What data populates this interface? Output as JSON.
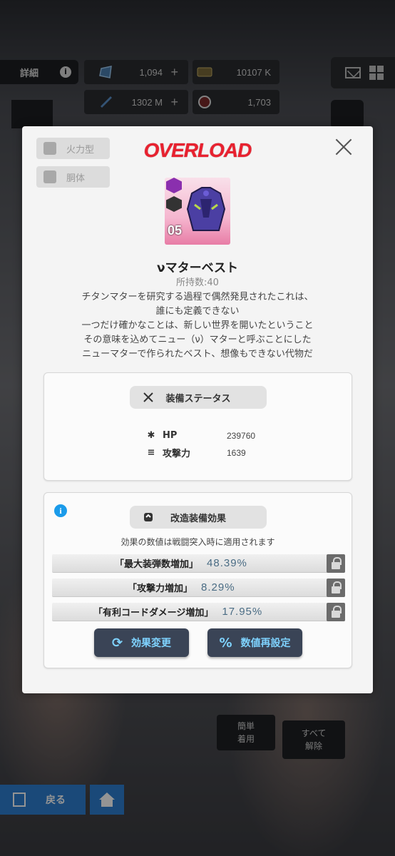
{
  "hud": {
    "detail_label": "詳細",
    "gems": "1,094",
    "credits": "10107 K",
    "battle_data": "1302 M",
    "core_dust": "1,703"
  },
  "background": {
    "back_label": "戻る",
    "simple_equip_label": "簡単\n着用",
    "unequip_all_label": "すべて\n解除"
  },
  "modal": {
    "tag_class": "火力型",
    "tag_slot": "胴体",
    "header": "OVERLOAD",
    "tier": "05",
    "item_name": "νマターベスト",
    "owned": "所持数:40",
    "description": [
      "チタンマターを研究する過程で偶然発見されたこれは、",
      "誰にも定義できない",
      "一つだけ確かなことは、新しい世界を開いたということ",
      "その意味を込めてニュー（ν）マターと呼ぶことにした",
      "ニューマターで作られたベスト、想像もできない代物だ"
    ],
    "status": {
      "title": "装備ステータス",
      "hp_label": "HP",
      "hp_value": "239760",
      "atk_label": "攻撃力",
      "atk_value": "1639"
    },
    "overload": {
      "title": "改造装備効果",
      "note": "効果の数値は戦闘突入時に適用されます",
      "effects": [
        {
          "name": "「最大装弾数増加」",
          "value": "48.39%"
        },
        {
          "name": "「攻撃力増加」",
          "value": "8.29%"
        },
        {
          "name": "「有利コードダメージ増加」",
          "value": "17.95%"
        }
      ],
      "change_button": "効果変更",
      "reset_button": "数値再設定"
    }
  },
  "colors": {
    "accent_red": "#e8212f",
    "value_blue": "#4a6c84",
    "button_bg": "#3a4456",
    "button_text": "#7fd3ff",
    "info_blue": "#1a9bea"
  }
}
